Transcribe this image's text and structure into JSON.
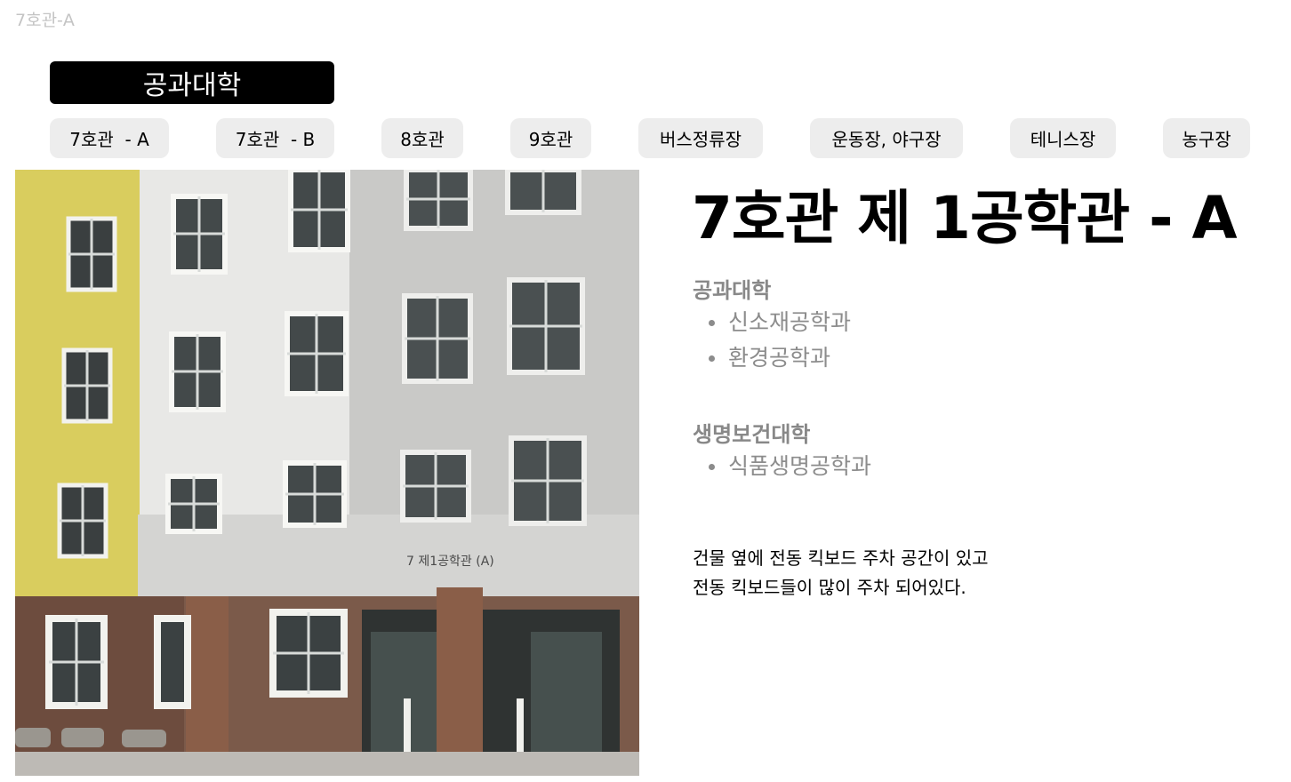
{
  "page": {
    "label": "7호관-A"
  },
  "header": {
    "college": "공과대학"
  },
  "tabs": [
    {
      "label": "7호관  - A"
    },
    {
      "label": "7호관  - B"
    },
    {
      "label": "8호관"
    },
    {
      "label": "9호관"
    },
    {
      "label": "버스정류장"
    },
    {
      "label": "운동장, 야구장"
    },
    {
      "label": "테니스장"
    },
    {
      "label": "농구장"
    }
  ],
  "main": {
    "title": "7호관 제 1공학관 - A",
    "photo_sign": "7 제1공학관 (A)",
    "sections": [
      {
        "heading": "공과대학",
        "items": [
          "신소재공학과",
          "환경공학과"
        ]
      },
      {
        "heading": "생명보건대학",
        "items": [
          "식품생명공학과"
        ]
      }
    ],
    "description": {
      "line1": "건물 옆에 전동 킥보드 주차 공간이 있고",
      "line2": "전동 킥보드들이 많이 주차 되어있다."
    }
  }
}
